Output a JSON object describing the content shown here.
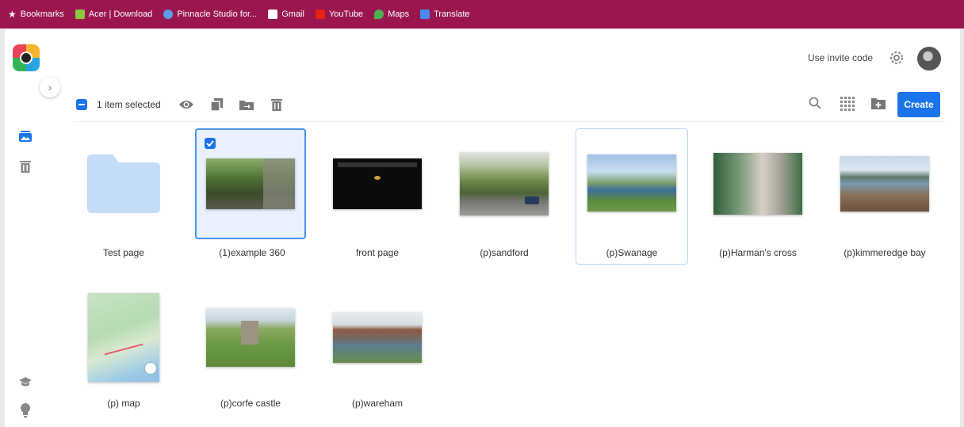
{
  "bookmarks_bar": {
    "items": [
      {
        "label": "Bookmarks",
        "icon": "star-icon"
      },
      {
        "label": "Acer | Download",
        "icon": "acer-icon"
      },
      {
        "label": "Pinnacle Studio for...",
        "icon": "pinnacle-icon"
      },
      {
        "label": "Gmail",
        "icon": "gmail-icon"
      },
      {
        "label": "YouTube",
        "icon": "youtube-icon"
      },
      {
        "label": "Maps",
        "icon": "maps-icon"
      },
      {
        "label": "Translate",
        "icon": "translate-icon"
      }
    ]
  },
  "header": {
    "invite_label": "Use invite code"
  },
  "toolbar": {
    "selection_text": "1 item selected",
    "create_label": "Create"
  },
  "tiles": [
    {
      "label": "Test page",
      "type": "folder"
    },
    {
      "label": "(1)example 360",
      "type": "image",
      "selected": true
    },
    {
      "label": "front page",
      "type": "image"
    },
    {
      "label": "(p)sandford",
      "type": "image"
    },
    {
      "label": "(p)Swanage",
      "type": "image",
      "hovered": true
    },
    {
      "label": "(p)Harman's cross",
      "type": "image"
    },
    {
      "label": "(p)kimmeredge bay",
      "type": "image"
    },
    {
      "label": "(p) map",
      "type": "image"
    },
    {
      "label": "(p)corfe castle",
      "type": "image"
    },
    {
      "label": "(p)wareham",
      "type": "image"
    }
  ],
  "colors": {
    "bookmarks_bar": "#9b164f",
    "accent": "#1a73e8",
    "folder": "#c4dcf8"
  }
}
